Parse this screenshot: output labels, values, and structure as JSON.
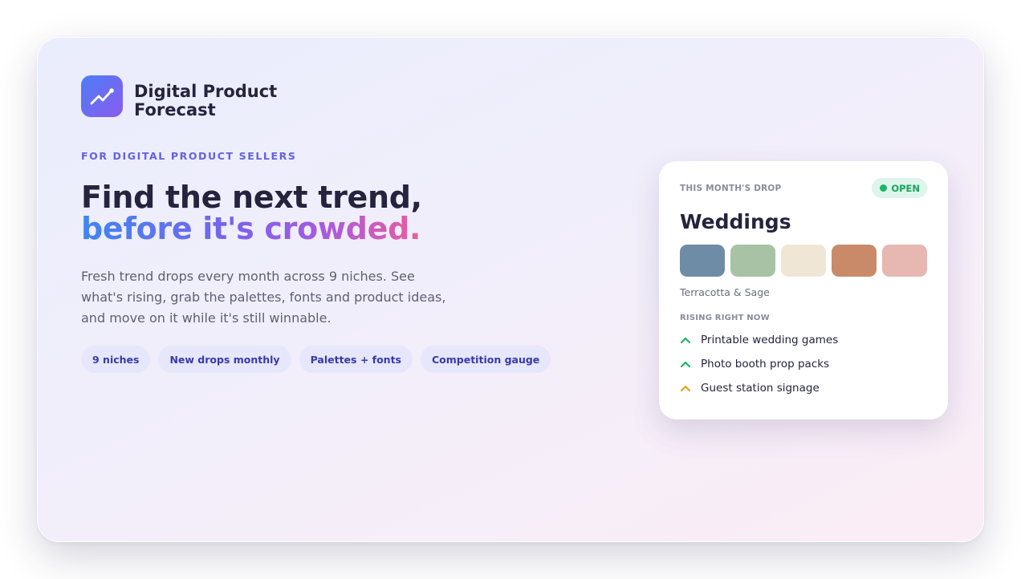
{
  "brand": {
    "name_line1": "Digital Product",
    "name_line2": "Forecast",
    "logo_icon": "trend-line-icon"
  },
  "hero": {
    "eyebrow": "FOR DIGITAL PRODUCT SELLERS",
    "headline_line1": "Find the next trend,",
    "headline_line2": "before it's crowded.",
    "description": "Fresh trend drops every month across 9 niches. See what's rising, grab the palettes, fonts and product ideas, and move on it while it's still winnable.",
    "chips": [
      "9 niches",
      "New drops monthly",
      "Palettes + fonts",
      "Competition gauge"
    ]
  },
  "drop_card": {
    "eyebrow": "THIS MONTH'S DROP",
    "status": "OPEN",
    "title": "Weddings",
    "palette_colors": [
      "#6e8ca6",
      "#a8c2a5",
      "#f0e6d6",
      "#c98a6a",
      "#e7b7b1"
    ],
    "palette_name": "Terracotta & Sage",
    "rising_label": "RISING RIGHT NOW",
    "rising": [
      {
        "label": "Printable wedding games",
        "icon": "chevron-up-icon",
        "color": "#1cb565"
      },
      {
        "label": "Photo booth prop packs",
        "icon": "chevron-up-icon",
        "color": "#1cb565"
      },
      {
        "label": "Guest station signage",
        "icon": "chevron-up-icon",
        "color": "#e6a318"
      }
    ]
  },
  "colors": {
    "accent": "#6361e0",
    "gradient_blue": "#3f86f1",
    "gradient_purple": "#a45be0",
    "gradient_pink": "#ec5c9c",
    "open_green": "#1cb565"
  }
}
